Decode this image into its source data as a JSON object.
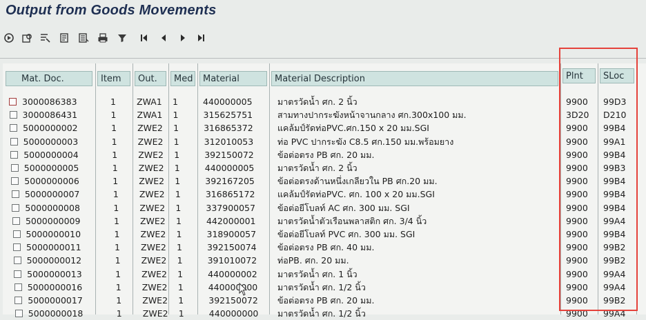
{
  "title": "Output from Goods Movements",
  "toolbar": [
    {
      "icon": "execute-icon"
    },
    {
      "icon": "display-icon"
    },
    {
      "icon": "select-icon"
    },
    {
      "icon": "details-icon"
    },
    {
      "icon": "list-icon"
    },
    {
      "icon": "print-icon"
    },
    {
      "icon": "filter-icon"
    },
    {
      "icon": "first-page-icon",
      "glyph": "|◀"
    },
    {
      "icon": "previous-page-icon",
      "glyph": "◀"
    },
    {
      "icon": "next-page-icon",
      "glyph": "▶"
    },
    {
      "icon": "last-page-icon",
      "glyph": "▶|"
    }
  ],
  "columns": {
    "mat_doc": "Mat. Doc.",
    "item": "Item",
    "out": "Out.",
    "med": "Med",
    "material": "Material",
    "description": "Material Description",
    "plnt": "Plnt",
    "sloc": "SLoc"
  },
  "rows": [
    {
      "mat_doc": "3000086383",
      "item": "1",
      "out": "ZWA1",
      "med": "1",
      "material": "440000005",
      "description": "มาตรวัดน้ำ ศก. 2 นิ้ว",
      "plnt": "9900",
      "sloc": "99D3"
    },
    {
      "mat_doc": "3000086431",
      "item": "1",
      "out": "ZWA1",
      "med": "1",
      "material": "315625751",
      "description": "สามทางปากระฆังหน้าจานกลาง ศก.300x100 มม.",
      "plnt": "3D20",
      "sloc": "D210"
    },
    {
      "mat_doc": "5000000002",
      "item": "1",
      "out": "ZWE2",
      "med": "1",
      "material": "316865372",
      "description": "แคล้มป์รัดท่อPVC.ศก.150 x 20 มม.SGI",
      "plnt": "9900",
      "sloc": "99B4"
    },
    {
      "mat_doc": "5000000003",
      "item": "1",
      "out": "ZWE2",
      "med": "1",
      "material": "312010053",
      "description": "ท่อ PVC ปากระฆัง C8.5 ศก.150 มม.พร้อมยาง",
      "plnt": "9900",
      "sloc": "99A1"
    },
    {
      "mat_doc": "5000000004",
      "item": "1",
      "out": "ZWE2",
      "med": "1",
      "material": "392150072",
      "description": "ข้อต่อตรง PB ศก. 20 มม.",
      "plnt": "9900",
      "sloc": "99B4"
    },
    {
      "mat_doc": "5000000005",
      "item": "1",
      "out": "ZWE2",
      "med": "1",
      "material": "440000005",
      "description": "มาตรวัดน้ำ ศก. 2 นิ้ว",
      "plnt": "9900",
      "sloc": "99B3"
    },
    {
      "mat_doc": "5000000006",
      "item": "1",
      "out": "ZWE2",
      "med": "1",
      "material": "392167205",
      "description": "ข้อต่อตรงด้านหนึ่งเกลียวใน PB ศก.20 มม.",
      "plnt": "9900",
      "sloc": "99B4"
    },
    {
      "mat_doc": "5000000007",
      "item": "1",
      "out": "ZWE2",
      "med": "1",
      "material": "316865172",
      "description": "แคล้มป์รัดท่อPVC. ศก. 100 x 20 มม.SGI",
      "plnt": "9900",
      "sloc": "99B4"
    },
    {
      "mat_doc": "5000000008",
      "item": "1",
      "out": "ZWE2",
      "med": "1",
      "material": "337900057",
      "description": "ข้อต่อยีโบลท์ AC ศก. 300 มม. SGI",
      "plnt": "9900",
      "sloc": "99B4"
    },
    {
      "mat_doc": "5000000009",
      "item": "1",
      "out": "ZWE2",
      "med": "1",
      "material": "442000001",
      "description": "มาตรวัดน้ำตัวเรือนพลาสติก ศก. 3/4 นิ้ว",
      "plnt": "9900",
      "sloc": "99A4"
    },
    {
      "mat_doc": "5000000010",
      "item": "1",
      "out": "ZWE2",
      "med": "1",
      "material": "318900057",
      "description": "ข้อต่อยีโบลท์ PVC ศก. 300 มม. SGI",
      "plnt": "9900",
      "sloc": "99B4"
    },
    {
      "mat_doc": "5000000011",
      "item": "1",
      "out": "ZWE2",
      "med": "1",
      "material": "392150074",
      "description": "ข้อต่อตรง PB ศก. 40 มม.",
      "plnt": "9900",
      "sloc": "99B2"
    },
    {
      "mat_doc": "5000000012",
      "item": "1",
      "out": "ZWE2",
      "med": "1",
      "material": "391010072",
      "description": "ท่อPB. ศก. 20 มม.",
      "plnt": "9900",
      "sloc": "99B2"
    },
    {
      "mat_doc": "5000000013",
      "item": "1",
      "out": "ZWE2",
      "med": "1",
      "material": "440000002",
      "description": "มาตรวัดน้ำ ศก. 1 นิ้ว",
      "plnt": "9900",
      "sloc": "99A4"
    },
    {
      "mat_doc": "5000000016",
      "item": "1",
      "out": "ZWE2",
      "med": "1",
      "material": "440000000",
      "description": "มาตรวัดน้ำ ศก. 1/2 นิ้ว",
      "plnt": "9900",
      "sloc": "99A4"
    },
    {
      "mat_doc": "5000000017",
      "item": "1",
      "out": "ZWE2",
      "med": "1",
      "material": "392150072",
      "description": "ข้อต่อตรง PB ศก. 20 มม.",
      "plnt": "9900",
      "sloc": "99B2"
    },
    {
      "mat_doc": "5000000018",
      "item": "1",
      "out": "ZWE2",
      "med": "1",
      "material": "440000000",
      "description": "มาตรวัดน้ำ ศก. 1/2 นิ้ว",
      "plnt": "9900",
      "sloc": "99A4"
    }
  ],
  "colors": {
    "header_bg": "#cfe3e0",
    "highlight_box": "#e5413a",
    "title": "#1e2f52"
  }
}
